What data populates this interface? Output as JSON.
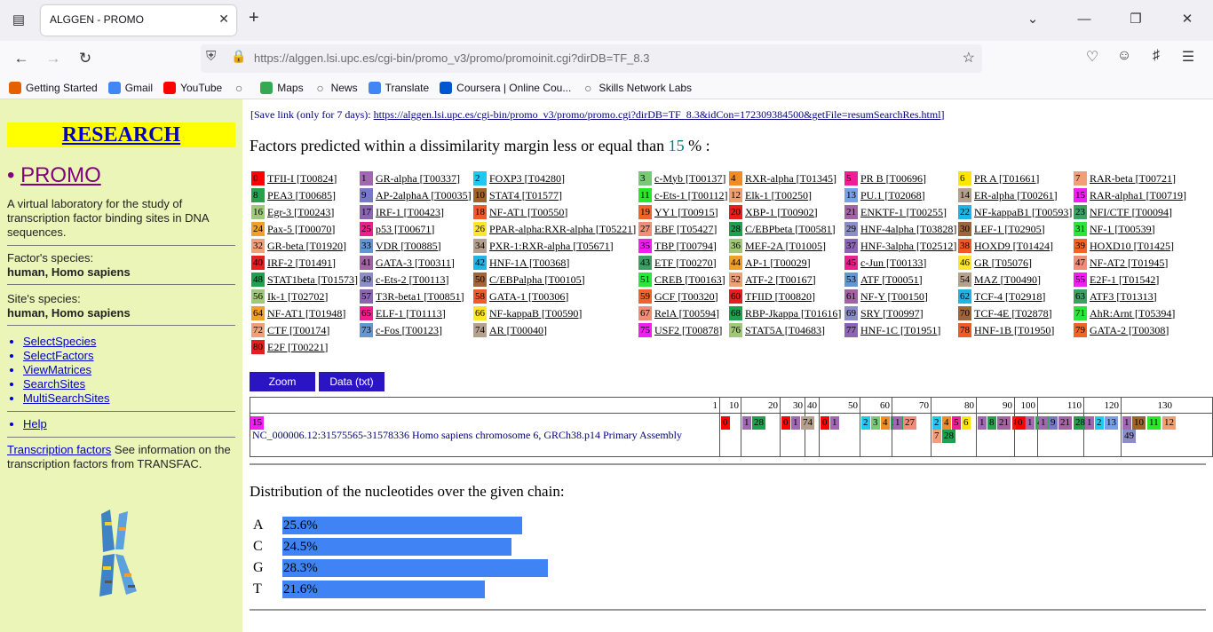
{
  "browser": {
    "tab_title": "ALGGEN - PROMO",
    "url": "https://alggen.lsi.upc.es/cgi-bin/promo_v3/promo/promoinit.cgi?dirDB=TF_8.3",
    "bookmarks": [
      {
        "label": "Getting Started",
        "icon": "firefox-icon",
        "color": "#e66000"
      },
      {
        "label": "Gmail",
        "icon": "google-icon",
        "color": "#4285f4"
      },
      {
        "label": "YouTube",
        "icon": "youtube-icon",
        "color": "#ff0000"
      },
      {
        "label": "",
        "icon": "globe-icon",
        "color": "#555555"
      },
      {
        "label": "Maps",
        "icon": "maps-icon",
        "color": "#34a853"
      },
      {
        "label": "News",
        "icon": "globe-icon",
        "color": "#555555"
      },
      {
        "label": "Translate",
        "icon": "translate-icon",
        "color": "#4285f4"
      },
      {
        "label": "Coursera | Online Cou...",
        "icon": "coursera-icon",
        "color": "#0056d2"
      },
      {
        "label": "Skills Network Labs",
        "icon": "globe-icon",
        "color": "#555555"
      }
    ]
  },
  "sidebar": {
    "title": "RESEARCH",
    "promo": "PROMO",
    "description": "A virtual laboratory for the study of transcription factor binding sites in DNA sequences.",
    "factor_species_label": "Factor's species:",
    "factor_species": "human, Homo sapiens",
    "site_species_label": "Site's species:",
    "site_species": "human, Homo sapiens",
    "links": [
      " SelectSpecies",
      " SelectFactors",
      " ViewMatrices",
      " SearchSites",
      " MultiSearchSites"
    ],
    "help": "Help",
    "tf_link": "Transcription factors",
    "tf_text": " See information on the transcription factors from TRANSFAC."
  },
  "main": {
    "save_prefix": "[Save link (only for 7 days): ",
    "save_url": "https://alggen.lsi.upc.es/cgi-bin/promo_v3/promo/promo.cgi?dirDB=TF_8.3&idCon=172309384500&getFile=resumSearchRes.html",
    "save_suffix": "]",
    "heading_pre": "Factors predicted within a dissimilarity margin less or equal than ",
    "heading_num": "15",
    "heading_post": " % :",
    "zoom_label": "Zoom",
    "data_label": "Data (txt)",
    "sequence_label": "NC_000006.12:31575565-31578336 Homo sapiens chromosome 6, GRCh38.p14 Primary Assembly",
    "ruler_ticks": [
      "1",
      "10",
      "20",
      "30",
      "40",
      "50",
      "60",
      "70",
      "80",
      "90",
      "100",
      "110",
      "120",
      "130"
    ],
    "dist_title": "Distribution of the nucleotides over the given chain:",
    "distribution": [
      {
        "base": "A",
        "label": "25.6%",
        "value": 25.6
      },
      {
        "base": "C",
        "label": "24.5%",
        "value": 24.5
      },
      {
        "base": "G",
        "label": "28.3%",
        "value": 28.3
      },
      {
        "base": "T",
        "label": "21.6%",
        "value": 21.6
      }
    ]
  },
  "factors": [
    {
      "n": "0",
      "name": "TFII-I [T00824]",
      "color": "#ff0000"
    },
    {
      "n": "1",
      "name": "GR-alpha [T00337]",
      "color": "#a068b0"
    },
    {
      "n": "2",
      "name": "FOXP3 [T04280]",
      "color": "#1ec8f0"
    },
    {
      "n": "3",
      "name": "c-Myb [T00137]",
      "color": "#78c878"
    },
    {
      "n": "4",
      "name": "RXR-alpha [T01345]",
      "color": "#f08c28"
    },
    {
      "n": "5",
      "name": "PR B [T00696]",
      "color": "#f01e96"
    },
    {
      "n": "6",
      "name": "PR A [T01661]",
      "color": "#ffe600"
    },
    {
      "n": "7",
      "name": "RAR-beta [T00721]",
      "color": "#f0a078"
    },
    {
      "n": "8",
      "name": "PEA3 [T00685]",
      "color": "#28a050"
    },
    {
      "n": "9",
      "name": "AP-2alphaA [T00035]",
      "color": "#7878c8"
    },
    {
      "n": "10",
      "name": "STAT4 [T01577]",
      "color": "#a06428"
    },
    {
      "n": "11",
      "name": "c-Ets-1 [T00112]",
      "color": "#28e628"
    },
    {
      "n": "12",
      "name": "Elk-1 [T00250]",
      "color": "#f0a070"
    },
    {
      "n": "13",
      "name": "PU.1 [T02068]",
      "color": "#78a0e6"
    },
    {
      "n": "14",
      "name": "ER-alpha [T00261]",
      "color": "#b4a08c"
    },
    {
      "n": "15",
      "name": "RAR-alpha1 [T00719]",
      "color": "#f01ef0"
    },
    {
      "n": "16",
      "name": "Egr-3 [T00243]",
      "color": "#a0c878"
    },
    {
      "n": "17",
      "name": "IRF-1 [T00423]",
      "color": "#8c64b4"
    },
    {
      "n": "18",
      "name": "NF-AT1 [T00550]",
      "color": "#f05a28"
    },
    {
      "n": "19",
      "name": "YY1 [T00915]",
      "color": "#f06428"
    },
    {
      "n": "20",
      "name": "XBP-1 [T00902]",
      "color": "#e61e1e"
    },
    {
      "n": "21",
      "name": "ENKTF-1 [T00255]",
      "color": "#a064a0"
    },
    {
      "n": "22",
      "name": "NF-kappaB1 [T00593]",
      "color": "#1eb4e6"
    },
    {
      "n": "23",
      "name": "NFI/CTF [T00094]",
      "color": "#3ca064"
    },
    {
      "n": "24",
      "name": "Pax-5 [T00070]",
      "color": "#f0a028"
    },
    {
      "n": "25",
      "name": "p53 [T00671]",
      "color": "#f01e8c"
    },
    {
      "n": "26",
      "name": "PPAR-alpha:RXR-alpha [T05221]",
      "color": "#ffe628"
    },
    {
      "n": "27",
      "name": "EBF [T05427]",
      "color": "#f08c78"
    },
    {
      "n": "28",
      "name": "C/EBPbeta [T00581]",
      "color": "#1ea050"
    },
    {
      "n": "29",
      "name": "HNF-4alpha [T03828]",
      "color": "#8c8cc8"
    },
    {
      "n": "30",
      "name": "LEF-1 [T02905]",
      "color": "#a0643c"
    },
    {
      "n": "31",
      "name": "NF-1 [T00539]",
      "color": "#28e63c"
    },
    {
      "n": "32",
      "name": "GR-beta [T01920]",
      "color": "#f0a078"
    },
    {
      "n": "33",
      "name": "VDR [T00885]",
      "color": "#6496d2"
    },
    {
      "n": "34",
      "name": "PXR-1:RXR-alpha [T05671]",
      "color": "#b4a08c"
    },
    {
      "n": "35",
      "name": "TBP [T00794]",
      "color": "#f01ef0"
    },
    {
      "n": "36",
      "name": "MEF-2A [T01005]",
      "color": "#a0c878"
    },
    {
      "n": "37",
      "name": "HNF-3alpha [T02512]",
      "color": "#8c64b4"
    },
    {
      "n": "38",
      "name": "HOXD9 [T01424]",
      "color": "#f05a28"
    },
    {
      "n": "39",
      "name": "HOXD10 [T01425]",
      "color": "#f06428"
    },
    {
      "n": "40",
      "name": "IRF-2 [T01491]",
      "color": "#e61e1e"
    },
    {
      "n": "41",
      "name": "GATA-3 [T00311]",
      "color": "#a064a0"
    },
    {
      "n": "42",
      "name": "HNF-1A [T00368]",
      "color": "#1eb4e6"
    },
    {
      "n": "43",
      "name": "ETF [T00270]",
      "color": "#3ca064"
    },
    {
      "n": "44",
      "name": "AP-1 [T00029]",
      "color": "#f0a028"
    },
    {
      "n": "45",
      "name": "c-Jun [T00133]",
      "color": "#f01e8c"
    },
    {
      "n": "46",
      "name": "GR [T05076]",
      "color": "#ffe628"
    },
    {
      "n": "47",
      "name": "NF-AT2 [T01945]",
      "color": "#f08c78"
    },
    {
      "n": "48",
      "name": "STAT1beta [T01573]",
      "color": "#1ea050"
    },
    {
      "n": "49",
      "name": "c-Ets-2 [T00113]",
      "color": "#8c8cc8"
    },
    {
      "n": "50",
      "name": "C/EBPalpha [T00105]",
      "color": "#a0643c"
    },
    {
      "n": "51",
      "name": "CREB [T00163]",
      "color": "#28e63c"
    },
    {
      "n": "52",
      "name": "ATF-2 [T00167]",
      "color": "#f0a078"
    },
    {
      "n": "53",
      "name": "ATF [T00051]",
      "color": "#6496d2"
    },
    {
      "n": "54",
      "name": "MAZ [T00490]",
      "color": "#b4a08c"
    },
    {
      "n": "55",
      "name": "E2F-1 [T01542]",
      "color": "#f01ef0"
    },
    {
      "n": "56",
      "name": "Ik-1 [T02702]",
      "color": "#a0c878"
    },
    {
      "n": "57",
      "name": "T3R-beta1 [T00851]",
      "color": "#8c64b4"
    },
    {
      "n": "58",
      "name": "GATA-1 [T00306]",
      "color": "#f05a28"
    },
    {
      "n": "59",
      "name": "GCF [T00320]",
      "color": "#f06428"
    },
    {
      "n": "60",
      "name": "TFIID [T00820]",
      "color": "#e61e1e"
    },
    {
      "n": "61",
      "name": "NF-Y [T00150]",
      "color": "#a064a0"
    },
    {
      "n": "62",
      "name": "TCF-4 [T02918]",
      "color": "#1eb4e6"
    },
    {
      "n": "63",
      "name": "ATF3 [T01313]",
      "color": "#3ca064"
    },
    {
      "n": "64",
      "name": "NF-AT1 [T01948]",
      "color": "#f0a028"
    },
    {
      "n": "65",
      "name": "ELF-1 [T01113]",
      "color": "#f01e8c"
    },
    {
      "n": "66",
      "name": "NF-kappaB [T00590]",
      "color": "#ffe628"
    },
    {
      "n": "67",
      "name": "RelA [T00594]",
      "color": "#f08c78"
    },
    {
      "n": "68",
      "name": "RBP-Jkappa [T01616]",
      "color": "#1ea050"
    },
    {
      "n": "69",
      "name": "SRY [T00997]",
      "color": "#8c8cc8"
    },
    {
      "n": "70",
      "name": "TCF-4E [T02878]",
      "color": "#a0643c"
    },
    {
      "n": "71",
      "name": "AhR:Arnt [T05394]",
      "color": "#28e63c"
    },
    {
      "n": "72",
      "name": "CTF [T00174]",
      "color": "#f0a078"
    },
    {
      "n": "73",
      "name": "c-Fos [T00123]",
      "color": "#6496d2"
    },
    {
      "n": "74",
      "name": "AR [T00040]",
      "color": "#b4a08c"
    },
    {
      "n": "75",
      "name": "USF2 [T00878]",
      "color": "#f01ef0"
    },
    {
      "n": "76",
      "name": "STAT5A [T04683]",
      "color": "#a0c878"
    },
    {
      "n": "77",
      "name": "HNF-1C [T01951]",
      "color": "#8c64b4"
    },
    {
      "n": "78",
      "name": "HNF-1B [T01950]",
      "color": "#f05a28"
    },
    {
      "n": "79",
      "name": "GATA-2 [T00308]",
      "color": "#f06428"
    },
    {
      "n": "80",
      "name": "E2F [T00221]",
      "color": "#e61e1e"
    }
  ],
  "map_marks": [
    {
      "n": "0",
      "color": "#ff0000",
      "col": 0,
      "row": 0
    },
    {
      "n": "1",
      "color": "#a068b0",
      "col": 1,
      "row": 0
    },
    {
      "n": "28",
      "color": "#1ea050",
      "col": 1,
      "row": 0
    },
    {
      "n": "0",
      "color": "#ff0000",
      "col": 2,
      "row": 0
    },
    {
      "n": "1",
      "color": "#a068b0",
      "col": 2,
      "row": 0
    },
    {
      "n": "74",
      "color": "#b4a08c",
      "col": 2,
      "row": 0
    },
    {
      "n": "0",
      "color": "#ff0000",
      "col": 4,
      "row": 0
    },
    {
      "n": "1",
      "color": "#a068b0",
      "col": 4,
      "row": 0
    },
    {
      "n": "2",
      "color": "#1ec8f0",
      "col": 5,
      "row": 0
    },
    {
      "n": "3",
      "color": "#78c878",
      "col": 5,
      "row": 0
    },
    {
      "n": "4",
      "color": "#f08c28",
      "col": 5,
      "row": 0
    },
    {
      "n": "28",
      "color": "#1ea050",
      "col": 5,
      "row": 0
    },
    {
      "n": "1",
      "color": "#a068b0",
      "col": 6,
      "row": 0
    },
    {
      "n": "27",
      "color": "#f08c78",
      "col": 6,
      "row": 0
    },
    {
      "n": "2",
      "color": "#1ec8f0",
      "col": 7,
      "row": 0
    },
    {
      "n": "4",
      "color": "#f08c28",
      "col": 7,
      "row": 0
    },
    {
      "n": "5",
      "color": "#f01e96",
      "col": 7,
      "row": 0
    },
    {
      "n": "6",
      "color": "#ffe600",
      "col": 7,
      "row": 0
    },
    {
      "n": "7",
      "color": "#f0a078",
      "col": 7,
      "row": 1
    },
    {
      "n": "28",
      "color": "#1ea050",
      "col": 7,
      "row": 1
    },
    {
      "n": "1",
      "color": "#a068b0",
      "col": 8,
      "row": 0
    },
    {
      "n": "8",
      "color": "#28a050",
      "col": 8,
      "row": 0
    },
    {
      "n": "21",
      "color": "#a064a0",
      "col": 8,
      "row": 0
    },
    {
      "n": "80",
      "color": "#e61e1e",
      "col": 8,
      "row": 0
    },
    {
      "n": "0",
      "color": "#ff0000",
      "col": 9,
      "row": 0
    },
    {
      "n": "1",
      "color": "#a068b0",
      "col": 9,
      "row": 0
    },
    {
      "n": "43",
      "color": "#3ca064",
      "col": 9,
      "row": 0
    },
    {
      "n": "1",
      "color": "#a068b0",
      "col": 10,
      "row": 0
    },
    {
      "n": "9",
      "color": "#7878c8",
      "col": 10,
      "row": 0
    },
    {
      "n": "21",
      "color": "#a064a0",
      "col": 10,
      "row": 0
    },
    {
      "n": "28",
      "color": "#1ea050",
      "col": 10,
      "row": 0
    },
    {
      "n": "1",
      "color": "#a068b0",
      "col": 11,
      "row": 0
    },
    {
      "n": "2",
      "color": "#1ec8f0",
      "col": 11,
      "row": 0
    },
    {
      "n": "13",
      "color": "#78a0e6",
      "col": 11,
      "row": 0
    },
    {
      "n": "1",
      "color": "#a068b0",
      "col": 12,
      "row": 0
    },
    {
      "n": "10",
      "color": "#a06428",
      "col": 12,
      "row": 0
    },
    {
      "n": "11",
      "color": "#28e628",
      "col": 12,
      "row": 0
    },
    {
      "n": "12",
      "color": "#f0a070",
      "col": 12,
      "row": 0
    },
    {
      "n": "49",
      "color": "#8c8cc8",
      "col": 12,
      "row": 1
    },
    {
      "n": "4",
      "color": "#f08c28",
      "col": 13,
      "row": 0
    },
    {
      "n": "14",
      "color": "#b4a08c",
      "col": 13,
      "row": 0
    },
    {
      "n": "15",
      "color": "#f01ef0",
      "col": 13,
      "row": 0
    }
  ]
}
